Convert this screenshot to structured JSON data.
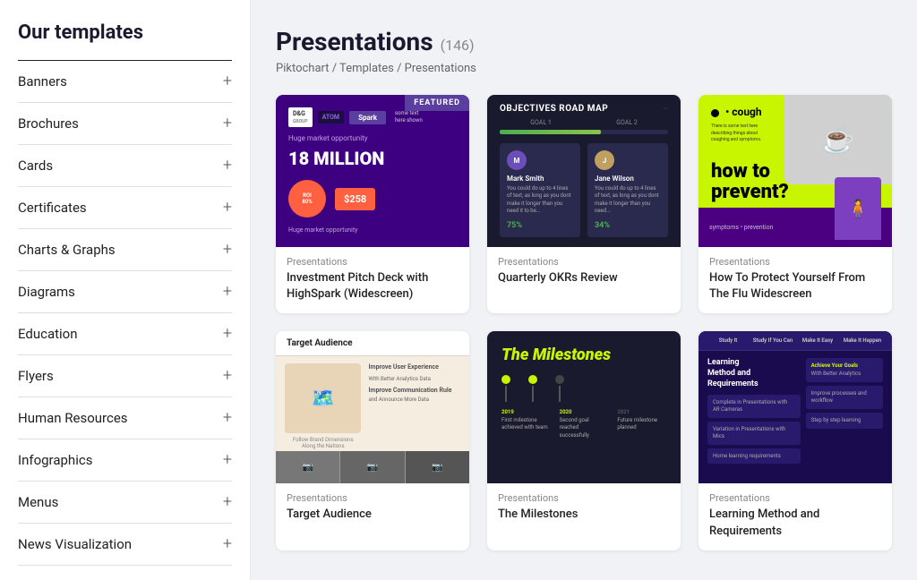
{
  "sidebar": {
    "title": "Our templates",
    "items": [
      {
        "id": "banners",
        "label": "Banners"
      },
      {
        "id": "brochures",
        "label": "Brochures"
      },
      {
        "id": "cards",
        "label": "Cards"
      },
      {
        "id": "certificates",
        "label": "Certificates"
      },
      {
        "id": "charts-graphs",
        "label": "Charts & Graphs"
      },
      {
        "id": "diagrams",
        "label": "Diagrams"
      },
      {
        "id": "education",
        "label": "Education"
      },
      {
        "id": "flyers",
        "label": "Flyers"
      },
      {
        "id": "human-resources",
        "label": "Human Resources"
      },
      {
        "id": "infographics",
        "label": "Infographics"
      },
      {
        "id": "menus",
        "label": "Menus"
      },
      {
        "id": "news-visualization",
        "label": "News Visualization"
      }
    ]
  },
  "page": {
    "title": "Presentations",
    "count": "(146)",
    "breadcrumb": "Piktochart / Templates / Presentations"
  },
  "templates": [
    {
      "id": "investment-pitch",
      "category": "Presentations",
      "name": "Investment Pitch Deck with HighSpark (Widescreen)"
    },
    {
      "id": "quarterly-okrs",
      "category": "Presentations",
      "name": "Quarterly OKRs Review"
    },
    {
      "id": "flu-prevention",
      "category": "Presentations",
      "name": "How To Protect Yourself From The Flu Widescreen"
    },
    {
      "id": "target-audience",
      "category": "Presentations",
      "name": "Target Audience"
    },
    {
      "id": "milestones",
      "category": "Presentations",
      "name": "The Milestones"
    },
    {
      "id": "learning-method",
      "category": "Presentations",
      "name": "Learning Method and Requirements"
    }
  ],
  "icons": {
    "plus": "+"
  }
}
